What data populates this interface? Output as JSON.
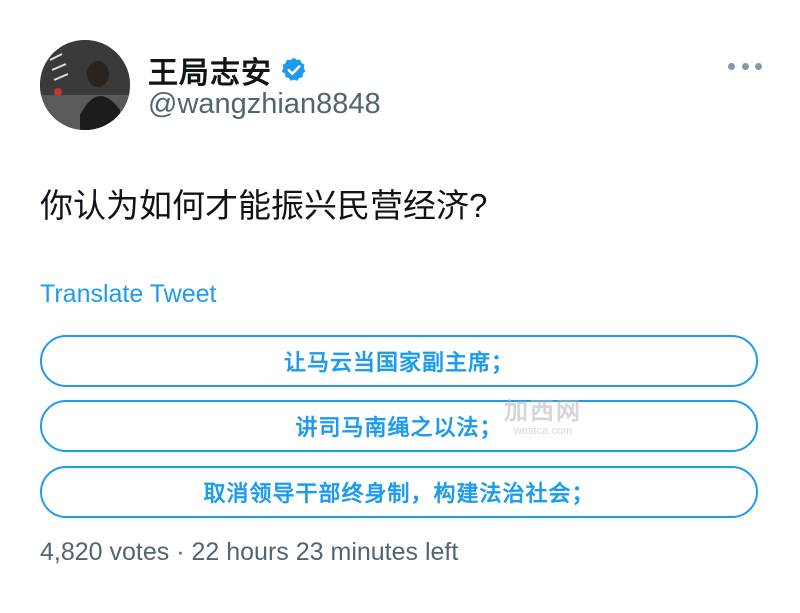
{
  "author": {
    "display_name": "王局志安",
    "handle": "@wangzhian8848",
    "verified": true
  },
  "tweet": {
    "text": "你认为如何才能振兴民营经济?",
    "translate_label": "Translate Tweet"
  },
  "poll": {
    "options": [
      {
        "label": "让马云当国家副主席；"
      },
      {
        "label": "讲司马南绳之以法；"
      },
      {
        "label": "取消领导干部终身制，构建法治社会；"
      }
    ],
    "votes": "4,820 votes",
    "separator": "·",
    "time_left": "22 hours 23 minutes left"
  },
  "watermark": {
    "main": "加西网",
    "sub": "westca.com"
  },
  "colors": {
    "accent": "#1d9bf0",
    "text": "#0f1419",
    "secondary": "#536471"
  },
  "icons": {
    "verified": "verified-badge-icon",
    "more": "more-dots-icon"
  }
}
